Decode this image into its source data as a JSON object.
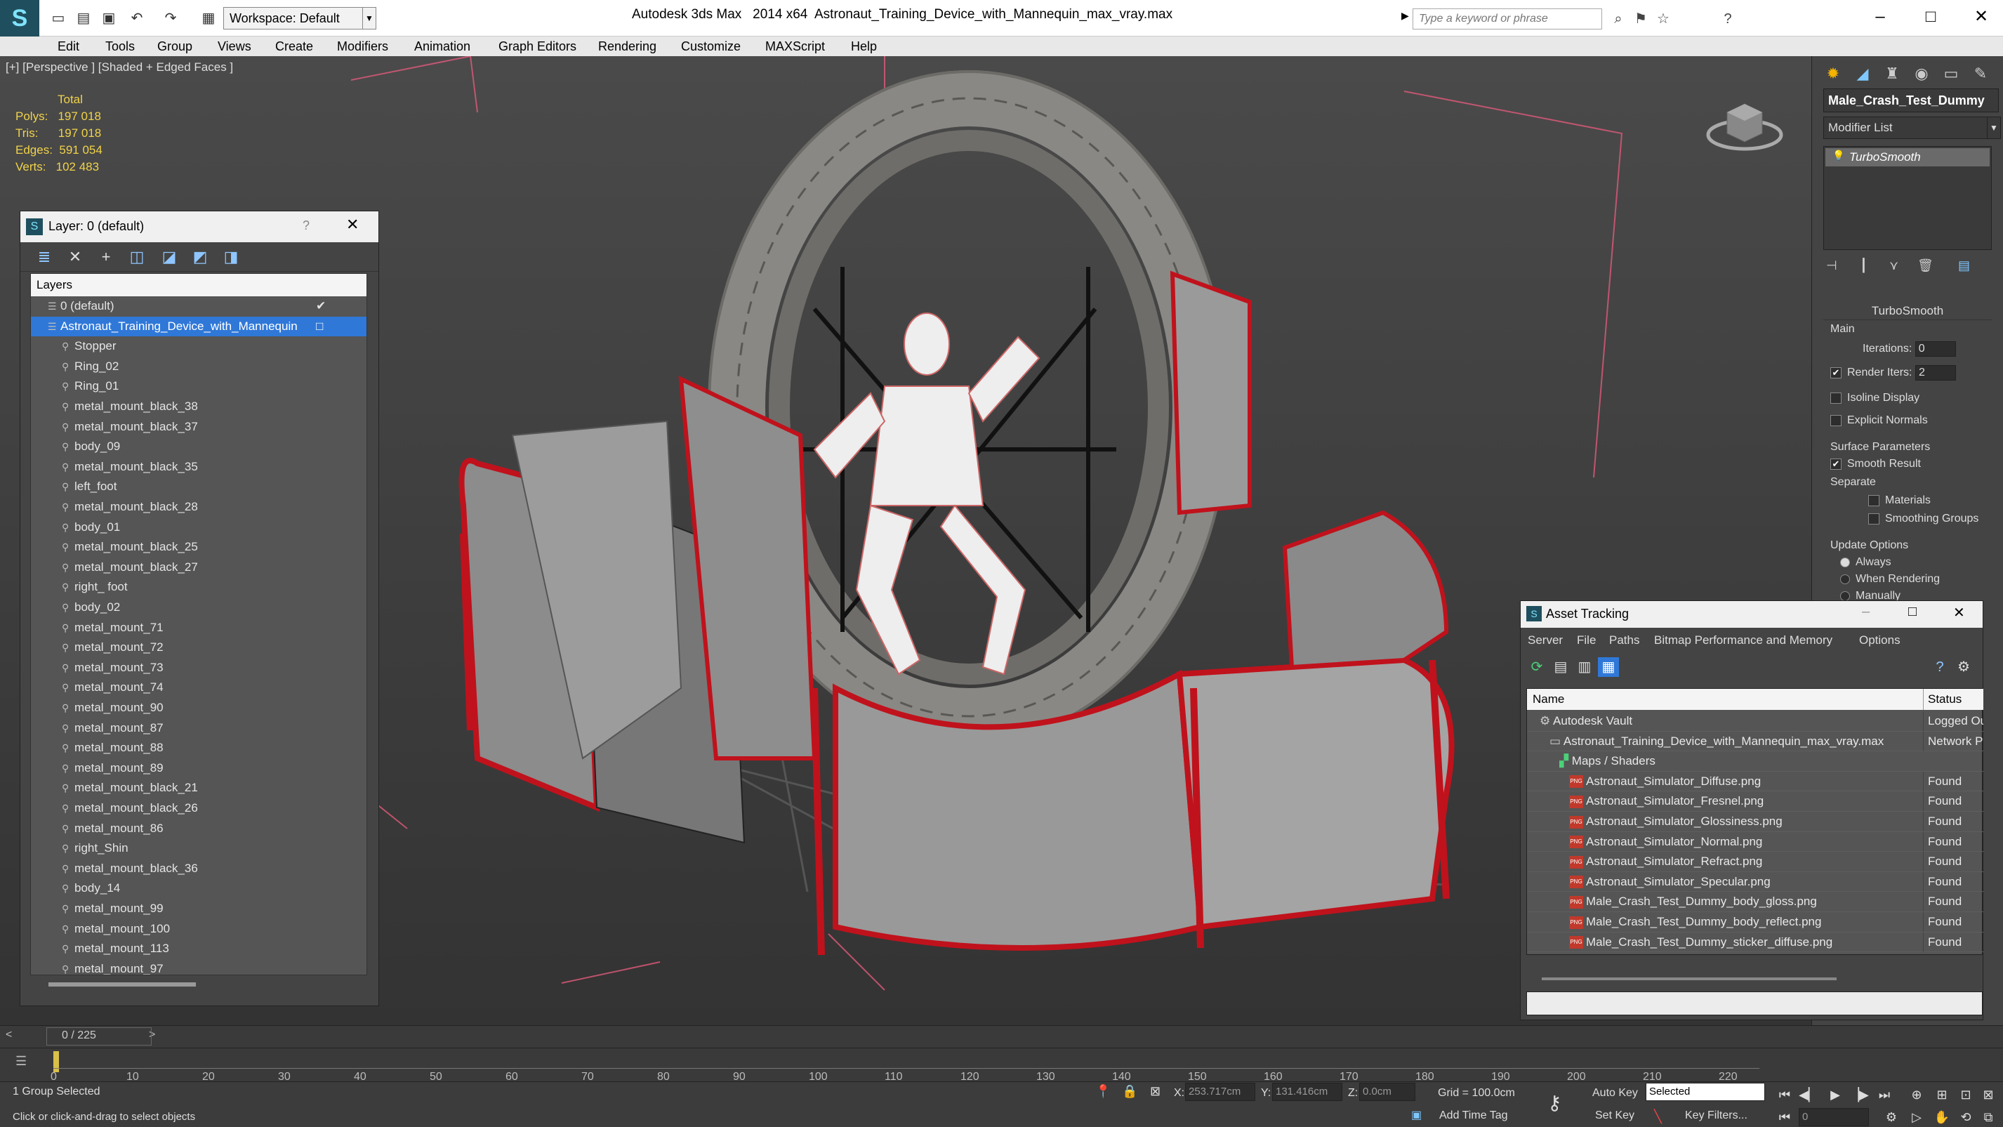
{
  "app": {
    "name": "Autodesk 3ds Max",
    "version": "2014 x64",
    "file": "Astronaut_Training_Device_with_Mannequin_max_vray.max"
  },
  "toolbar": {
    "workspace": "Workspace: Default",
    "search_placeholder": "Type a keyword or phrase"
  },
  "menu": [
    "Edit",
    "Tools",
    "Group",
    "Views",
    "Create",
    "Modifiers",
    "Animation",
    "Graph Editors",
    "Rendering",
    "Customize",
    "MAXScript",
    "Help"
  ],
  "viewport": {
    "label": "[+] [Perspective ] [Shaded + Edged Faces ]",
    "stats": {
      "title": "Total",
      "polys_label": "Polys:",
      "polys": "197 018",
      "tris_label": "Tris:",
      "tris": "197 018",
      "edges_label": "Edges:",
      "edges": "591 054",
      "verts_label": "Verts:",
      "verts": "102 483"
    }
  },
  "layers": {
    "title": "Layer: 0 (default)",
    "help": "?",
    "header": "Layers",
    "items": [
      "0 (default)",
      "Astronaut_Training_Device_with_Mannequin",
      "Stopper",
      "Ring_02",
      "Ring_01",
      "metal_mount_black_38",
      "metal_mount_black_37",
      "body_09",
      "metal_mount_black_35",
      "left_foot",
      "metal_mount_black_28",
      "body_01",
      "metal_mount_black_25",
      "metal_mount_black_27",
      "right_ foot",
      "body_02",
      "metal_mount_71",
      "metal_mount_72",
      "metal_mount_73",
      "metal_mount_74",
      "metal_mount_90",
      "metal_mount_87",
      "metal_mount_88",
      "metal_mount_89",
      "metal_mount_black_21",
      "metal_mount_black_26",
      "metal_mount_86",
      "right_Shin",
      "metal_mount_black_36",
      "body_14",
      "metal_mount_99",
      "metal_mount_100",
      "metal_mount_113",
      "metal_mount_97"
    ]
  },
  "command": {
    "object": "Male_Crash_Test_Dummy",
    "modifier_list": "Modifier List",
    "stack_item": "TurboSmooth",
    "rollout": "TurboSmooth",
    "main": "Main",
    "iterations_label": "Iterations:",
    "iterations": "0",
    "render_iters_label": "Render Iters:",
    "render_iters": "2",
    "isoline": "Isoline Display",
    "explicit": "Explicit Normals",
    "surface": "Surface Parameters",
    "smooth_result": "Smooth Result",
    "separate": "Separate",
    "materials": "Materials",
    "smoothing_groups": "Smoothing Groups",
    "update": "Update Options",
    "always": "Always",
    "when_rendering": "When Rendering",
    "manually": "Manually"
  },
  "asset": {
    "title": "Asset Tracking",
    "menu": [
      "Server",
      "File",
      "Paths",
      "Bitmap Performance and Memory",
      "Options"
    ],
    "col_name": "Name",
    "col_status": "Status",
    "rows": [
      {
        "name": "Autodesk Vault",
        "status": "Logged Out",
        "indent": 1,
        "icon": "vault"
      },
      {
        "name": "Astronaut_Training_Device_with_Mannequin_max_vray.max",
        "status": "Network Path",
        "indent": 2,
        "icon": "file"
      },
      {
        "name": "Maps / Shaders",
        "status": "",
        "indent": 3,
        "icon": "maps"
      },
      {
        "name": "Astronaut_Simulator_Diffuse.png",
        "status": "Found",
        "indent": 4,
        "icon": "png"
      },
      {
        "name": "Astronaut_Simulator_Fresnel.png",
        "status": "Found",
        "indent": 4,
        "icon": "png"
      },
      {
        "name": "Astronaut_Simulator_Glossiness.png",
        "status": "Found",
        "indent": 4,
        "icon": "png"
      },
      {
        "name": "Astronaut_Simulator_Normal.png",
        "status": "Found",
        "indent": 4,
        "icon": "png"
      },
      {
        "name": "Astronaut_Simulator_Refract.png",
        "status": "Found",
        "indent": 4,
        "icon": "png"
      },
      {
        "name": "Astronaut_Simulator_Specular.png",
        "status": "Found",
        "indent": 4,
        "icon": "png"
      },
      {
        "name": "Male_Crash_Test_Dummy_body_gloss.png",
        "status": "Found",
        "indent": 4,
        "icon": "png"
      },
      {
        "name": "Male_Crash_Test_Dummy_body_reflect.png",
        "status": "Found",
        "indent": 4,
        "icon": "png"
      },
      {
        "name": "Male_Crash_Test_Dummy_sticker_diffuse.png",
        "status": "Found",
        "indent": 4,
        "icon": "png"
      }
    ]
  },
  "timeline": {
    "frame": "0 / 225",
    "ticks": [
      "0",
      "10",
      "20",
      "30",
      "40",
      "50",
      "60",
      "70",
      "80",
      "90",
      "100",
      "110",
      "120",
      "130",
      "140",
      "150",
      "160",
      "170",
      "180",
      "190",
      "200",
      "210",
      "220"
    ]
  },
  "status": {
    "selection": "1 Group Selected",
    "prompt": "Click or click-and-drag to select objects",
    "x_label": "X:",
    "x": "253.717cm",
    "y_label": "Y:",
    "y": "131.416cm",
    "z_label": "Z:",
    "z": "0.0cm",
    "grid": "Grid = 100.0cm",
    "add_time_tag": "Add Time Tag",
    "auto_key": "Auto Key",
    "set_key": "Set Key",
    "selected": "Selected",
    "key_filters": "Key Filters...",
    "frame_field": "0"
  },
  "colors": {
    "selection": "#2f78d8",
    "stats": "#f0d24a",
    "frame_red": "#c0121c"
  }
}
